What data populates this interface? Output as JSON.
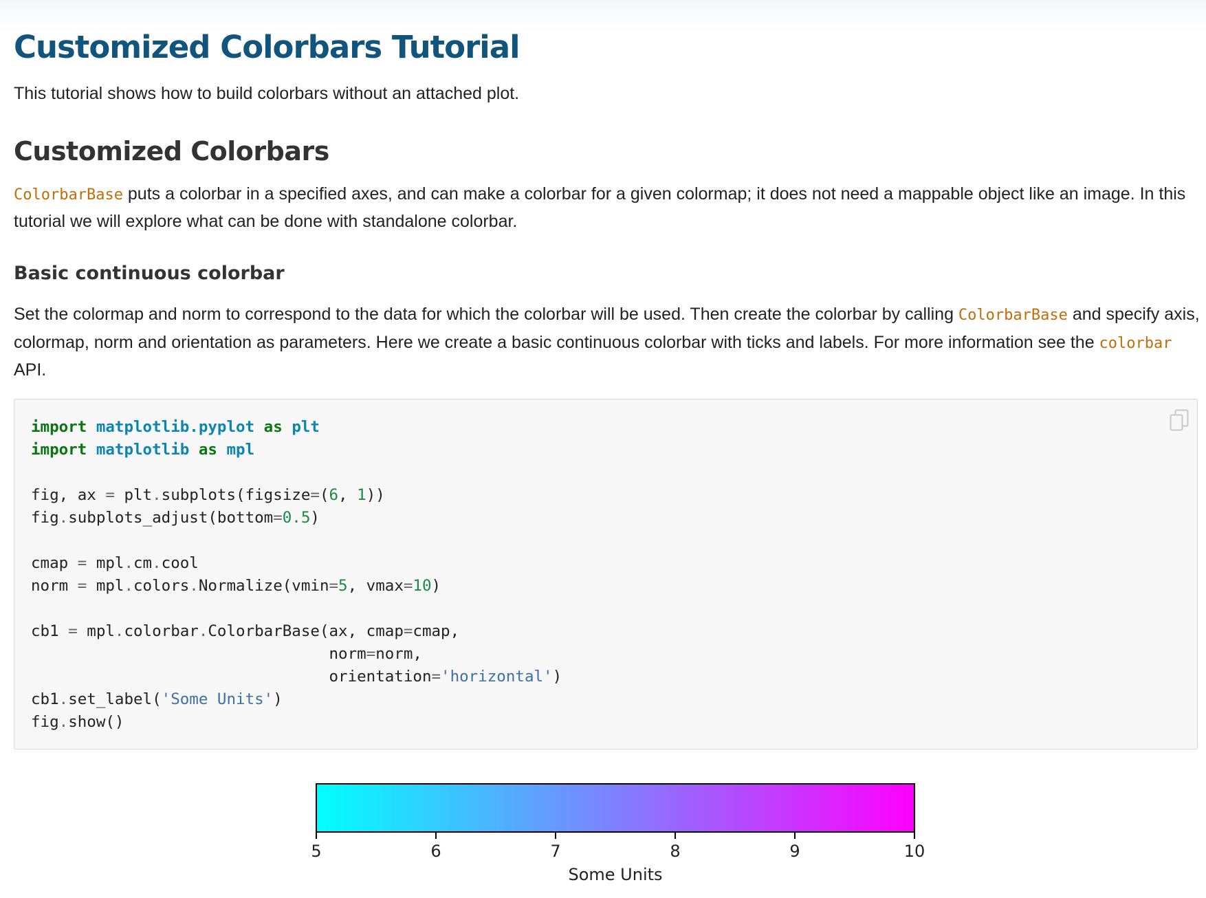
{
  "page": {
    "title": "Customized Colorbars Tutorial",
    "intro": "This tutorial shows how to build colorbars without an attached plot.",
    "section_heading": "Customized Colorbars",
    "section_para": {
      "code_link": "ColorbarBase",
      "text": " puts a colorbar in a specified axes, and can make a colorbar for a given colormap; it does not need a mappable object like an image. In this tutorial we will explore what can be done with standalone colorbar."
    },
    "subsection_heading": "Basic continuous colorbar",
    "subsection_para": {
      "part1": "Set the colormap and norm to correspond to the data for which the colorbar will be used. Then create the colorbar by calling ",
      "code1": "ColorbarBase",
      "part2": " and specify axis, colormap, norm and orientation as parameters. Here we create a basic continuous colorbar with ticks and labels. For more information see the ",
      "code2": "colorbar",
      "part3": " API."
    }
  },
  "code": {
    "copy_icon": "copy-icon",
    "lines": {
      "l1": {
        "kw1": "import",
        "mod1": "matplotlib.pyplot",
        "kw2": "as",
        "mod2": "plt"
      },
      "l2": {
        "kw1": "import",
        "mod1": "matplotlib",
        "kw2": "as",
        "mod2": "mpl"
      },
      "l4": {
        "a": "fig, ax ",
        "eq": "=",
        "b": " plt",
        "dot": ".",
        "c": "subplots(figsize",
        "eq2": "=",
        "d": "(",
        "n1": "6",
        "e": ", ",
        "n2": "1",
        "f": "))"
      },
      "l5": {
        "a": "fig",
        "dot": ".",
        "b": "subplots_adjust(bottom",
        "eq": "=",
        "n1": "0.5",
        "c": ")"
      },
      "l7": {
        "a": "cmap ",
        "eq": "=",
        "b": " mpl",
        "dot1": ".",
        "c": "cm",
        "dot2": ".",
        "d": "cool"
      },
      "l8": {
        "a": "norm ",
        "eq": "=",
        "b": " mpl",
        "dot1": ".",
        "c": "colors",
        "dot2": ".",
        "d": "Normalize(vmin",
        "eq2": "=",
        "n1": "5",
        "e": ", vmax",
        "eq3": "=",
        "n2": "10",
        "f": ")"
      },
      "l10": {
        "a": "cb1 ",
        "eq": "=",
        "b": " mpl",
        "dot1": ".",
        "c": "colorbar",
        "dot2": ".",
        "d": "ColorbarBase(ax, cmap",
        "eq2": "=",
        "e": "cmap,"
      },
      "l11": {
        "a": "                                norm",
        "eq": "=",
        "b": "norm,"
      },
      "l12": {
        "a": "                                orientation",
        "eq": "=",
        "s": "'horizontal'",
        "b": ")"
      },
      "l13": {
        "a": "cb1",
        "dot": ".",
        "b": "set_label(",
        "s": "'Some Units'",
        "c": ")"
      },
      "l14": {
        "a": "fig",
        "dot": ".",
        "b": "show()"
      }
    }
  },
  "chart_data": {
    "type": "colorbar",
    "orientation": "horizontal",
    "colormap": "cool",
    "colors": [
      "#00ffff",
      "#ff00ff"
    ],
    "vmin": 5,
    "vmax": 10,
    "xlim": [
      5,
      10
    ],
    "ticks": [
      5,
      6,
      7,
      8,
      9,
      10
    ],
    "tick_labels": [
      "5",
      "6",
      "7",
      "8",
      "9",
      "10"
    ],
    "xlabel": "Some Units"
  }
}
